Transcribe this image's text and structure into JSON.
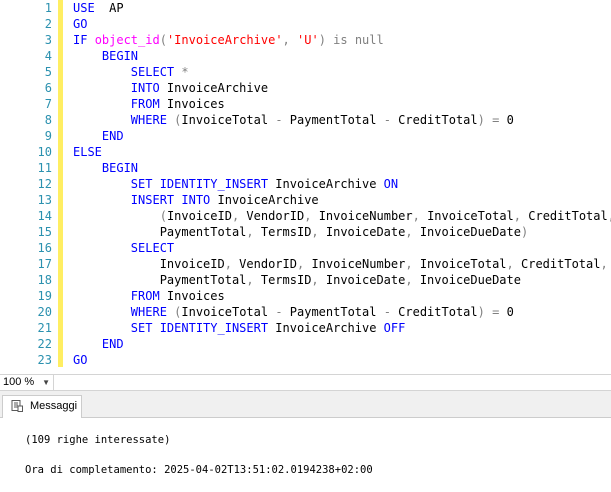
{
  "editor": {
    "lines": [
      {
        "n": "1",
        "segs": [
          [
            "kw",
            "USE"
          ],
          [
            "",
            "  AP"
          ]
        ]
      },
      {
        "n": "2",
        "segs": [
          [
            "kw",
            "GO"
          ]
        ]
      },
      {
        "n": "3",
        "segs": [
          [
            "kw",
            "IF"
          ],
          [
            "",
            " "
          ],
          [
            "fn",
            "object_id"
          ],
          [
            "gray",
            "("
          ],
          [
            "str",
            "'InvoiceArchive'"
          ],
          [
            "gray",
            ", "
          ],
          [
            "str",
            "'U'"
          ],
          [
            "gray",
            ")"
          ],
          [
            "",
            " "
          ],
          [
            "gray",
            "is null"
          ]
        ]
      },
      {
        "n": "4",
        "segs": [
          [
            "",
            "    "
          ],
          [
            "kw",
            "BEGIN"
          ]
        ]
      },
      {
        "n": "5",
        "segs": [
          [
            "",
            "        "
          ],
          [
            "kw",
            "SELECT"
          ],
          [
            "",
            " "
          ],
          [
            "gray",
            "*"
          ]
        ]
      },
      {
        "n": "6",
        "segs": [
          [
            "",
            "        "
          ],
          [
            "kw",
            "INTO"
          ],
          [
            "",
            " InvoiceArchive"
          ]
        ]
      },
      {
        "n": "7",
        "segs": [
          [
            "",
            "        "
          ],
          [
            "kw",
            "FROM"
          ],
          [
            "",
            " Invoices"
          ]
        ]
      },
      {
        "n": "8",
        "segs": [
          [
            "",
            "        "
          ],
          [
            "kw",
            "WHERE"
          ],
          [
            "",
            " "
          ],
          [
            "gray",
            "("
          ],
          [
            "",
            "InvoiceTotal "
          ],
          [
            "gray",
            "-"
          ],
          [
            "",
            " PaymentTotal "
          ],
          [
            "gray",
            "-"
          ],
          [
            "",
            " CreditTotal"
          ],
          [
            "gray",
            ")"
          ],
          [
            "",
            " "
          ],
          [
            "gray",
            "="
          ],
          [
            "",
            " 0"
          ]
        ]
      },
      {
        "n": "9",
        "segs": [
          [
            "",
            "    "
          ],
          [
            "kw",
            "END"
          ]
        ]
      },
      {
        "n": "10",
        "segs": [
          [
            "kw",
            "ELSE"
          ]
        ]
      },
      {
        "n": "11",
        "segs": [
          [
            "",
            "    "
          ],
          [
            "kw",
            "BEGIN"
          ]
        ]
      },
      {
        "n": "12",
        "segs": [
          [
            "",
            "        "
          ],
          [
            "kw",
            "SET IDENTITY_INSERT"
          ],
          [
            "",
            " InvoiceArchive "
          ],
          [
            "kw",
            "ON"
          ]
        ]
      },
      {
        "n": "13",
        "segs": [
          [
            "",
            "        "
          ],
          [
            "kw",
            "INSERT INTO"
          ],
          [
            "",
            " InvoiceArchive"
          ]
        ]
      },
      {
        "n": "14",
        "segs": [
          [
            "",
            "            "
          ],
          [
            "gray",
            "("
          ],
          [
            "",
            "InvoiceID"
          ],
          [
            "gray",
            ","
          ],
          [
            "",
            " VendorID"
          ],
          [
            "gray",
            ","
          ],
          [
            "",
            " InvoiceNumber"
          ],
          [
            "gray",
            ","
          ],
          [
            "",
            " InvoiceTotal"
          ],
          [
            "gray",
            ","
          ],
          [
            "",
            " CreditTotal"
          ],
          [
            "gray",
            ","
          ]
        ]
      },
      {
        "n": "15",
        "segs": [
          [
            "",
            "            PaymentTotal"
          ],
          [
            "gray",
            ","
          ],
          [
            "",
            " TermsID"
          ],
          [
            "gray",
            ","
          ],
          [
            "",
            " InvoiceDate"
          ],
          [
            "gray",
            ","
          ],
          [
            "",
            " InvoiceDueDate"
          ],
          [
            "gray",
            ")"
          ]
        ]
      },
      {
        "n": "16",
        "segs": [
          [
            "",
            "        "
          ],
          [
            "kw",
            "SELECT"
          ]
        ]
      },
      {
        "n": "17",
        "segs": [
          [
            "",
            "            InvoiceID"
          ],
          [
            "gray",
            ","
          ],
          [
            "",
            " VendorID"
          ],
          [
            "gray",
            ","
          ],
          [
            "",
            " InvoiceNumber"
          ],
          [
            "gray",
            ","
          ],
          [
            "",
            " InvoiceTotal"
          ],
          [
            "gray",
            ","
          ],
          [
            "",
            " CreditTotal"
          ],
          [
            "gray",
            ","
          ]
        ]
      },
      {
        "n": "18",
        "segs": [
          [
            "",
            "            PaymentTotal"
          ],
          [
            "gray",
            ","
          ],
          [
            "",
            " TermsID"
          ],
          [
            "gray",
            ","
          ],
          [
            "",
            " InvoiceDate"
          ],
          [
            "gray",
            ","
          ],
          [
            "",
            " InvoiceDueDate"
          ]
        ]
      },
      {
        "n": "19",
        "segs": [
          [
            "",
            "        "
          ],
          [
            "kw",
            "FROM"
          ],
          [
            "",
            " Invoices"
          ]
        ]
      },
      {
        "n": "20",
        "segs": [
          [
            "",
            "        "
          ],
          [
            "kw",
            "WHERE"
          ],
          [
            "",
            " "
          ],
          [
            "gray",
            "("
          ],
          [
            "",
            "InvoiceTotal "
          ],
          [
            "gray",
            "-"
          ],
          [
            "",
            " PaymentTotal "
          ],
          [
            "gray",
            "-"
          ],
          [
            "",
            " CreditTotal"
          ],
          [
            "gray",
            ")"
          ],
          [
            "",
            " "
          ],
          [
            "gray",
            "="
          ],
          [
            "",
            " 0"
          ]
        ]
      },
      {
        "n": "21",
        "segs": [
          [
            "",
            "        "
          ],
          [
            "kw",
            "SET IDENTITY_INSERT"
          ],
          [
            "",
            " InvoiceArchive "
          ],
          [
            "kw",
            "OFF"
          ]
        ]
      },
      {
        "n": "22",
        "segs": [
          [
            "",
            "    "
          ],
          [
            "kw",
            "END"
          ]
        ]
      },
      {
        "n": "23",
        "segs": [
          [
            "kw",
            "GO"
          ]
        ]
      }
    ]
  },
  "zoom": {
    "value": "100 %",
    "icon": "chevron-down-icon"
  },
  "results": {
    "tab_label": "Messaggi",
    "tab_icon": "messages-icon",
    "messages": [
      "(109 righe interessate)",
      "Ora di completamento: 2025-04-02T13:51:02.0194238+02:00"
    ]
  },
  "colors": {
    "keyword": "#0000ff",
    "function": "#ff00ff",
    "string": "#ff0000",
    "operator": "#808080",
    "line_number": "#2b91af",
    "change_bar": "#ffee62"
  }
}
